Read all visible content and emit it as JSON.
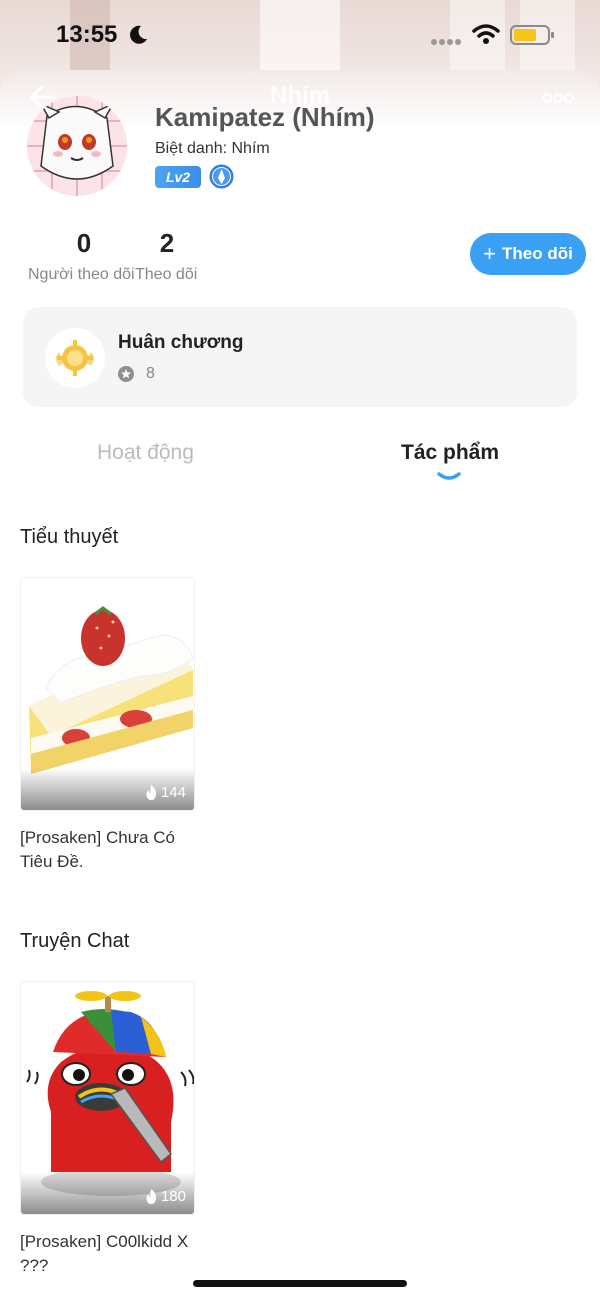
{
  "status_bar": {
    "time": "13:55"
  },
  "header": {
    "title": "Nhím"
  },
  "profile": {
    "name": "Kamipatez (Nhím)",
    "nickname": "Biệt danh: Nhím",
    "level": "Lv2"
  },
  "stats": {
    "followers": {
      "value": "0",
      "label": "Người theo dõi"
    },
    "following": {
      "value": "2",
      "label": "Theo dõi"
    }
  },
  "follow_button": {
    "label": "Theo dõi"
  },
  "medals": {
    "title": "Huân chương",
    "count": "8"
  },
  "tabs": [
    {
      "label": "Hoạt động",
      "active": false
    },
    {
      "label": "Tác phẩm",
      "active": true
    }
  ],
  "sections": [
    {
      "title": "Tiểu thuyết",
      "items": [
        {
          "title": "[Prosaken] Chưa Có Tiêu Đề.",
          "views": "144",
          "cover": "strawberry-cake"
        }
      ]
    },
    {
      "title": "Truyện Chat",
      "items": [
        {
          "title": "[Prosaken] C00lkidd X ???",
          "views": "180",
          "cover": "red-character-propeller-hat"
        }
      ]
    }
  ],
  "colors": {
    "accent": "#3aa0f3",
    "level_badge": "#4aa5f1",
    "medal_gold": "#f5c542"
  }
}
